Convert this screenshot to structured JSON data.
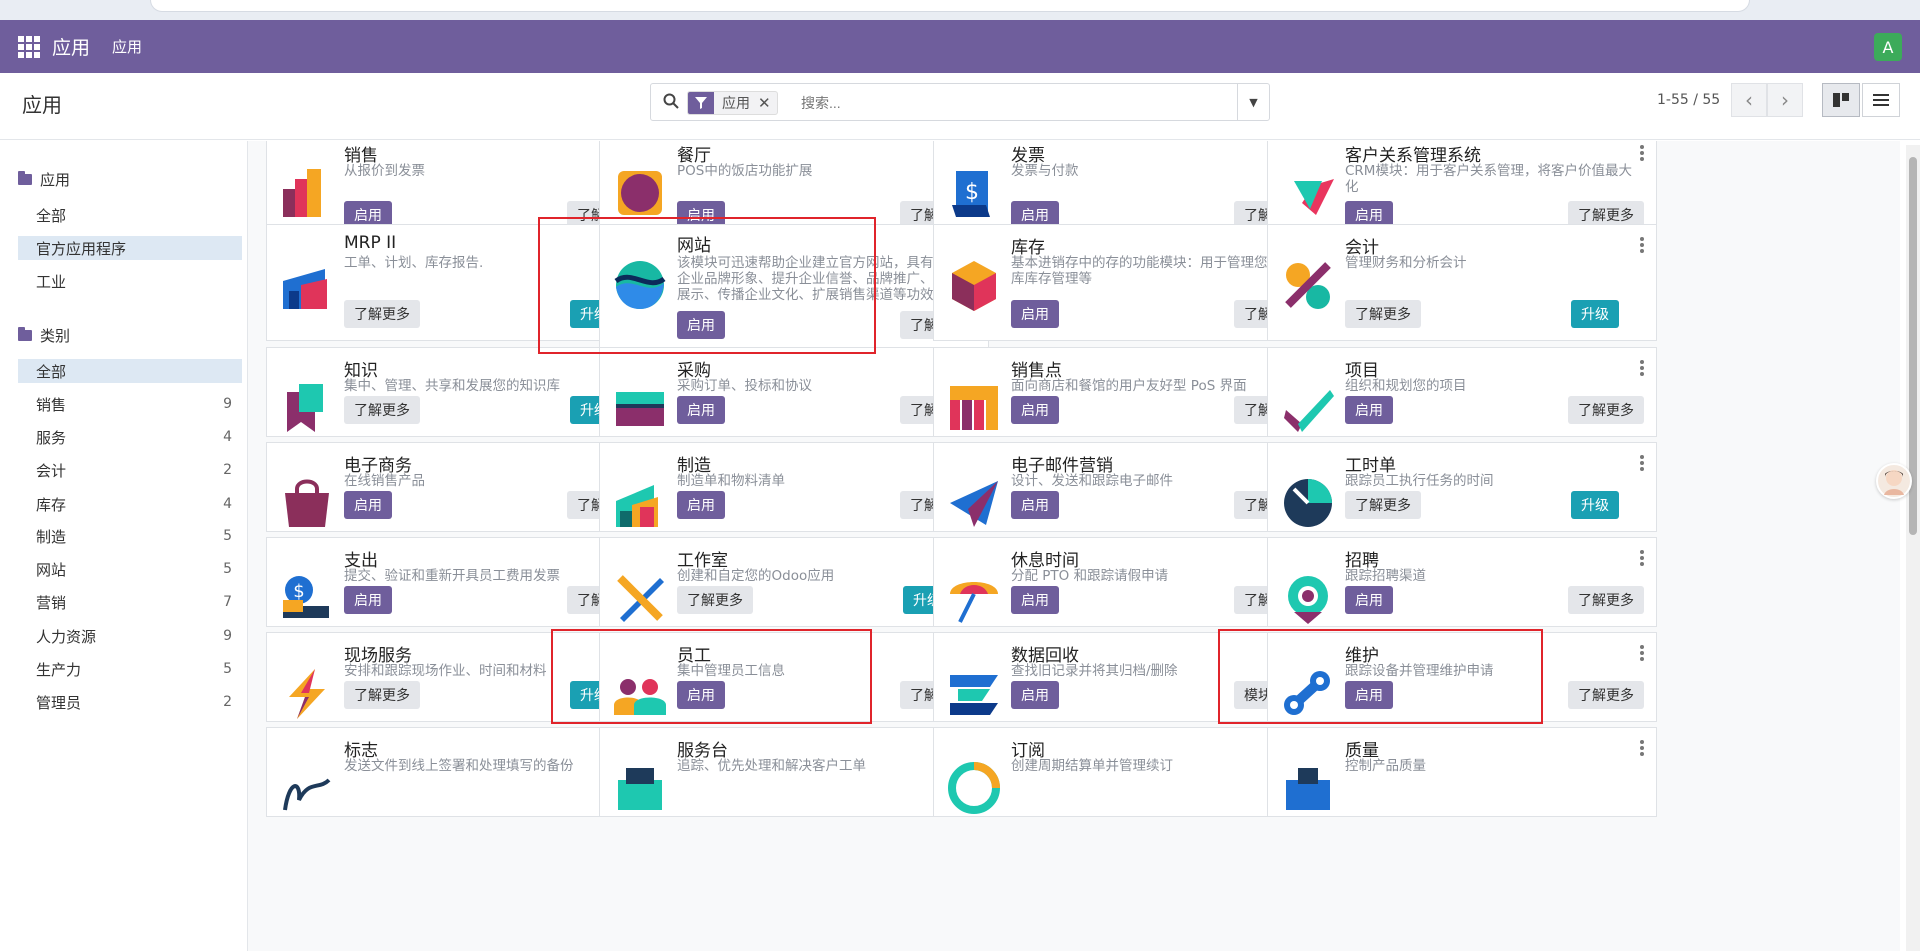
{
  "topnav": {
    "brand": "应用",
    "menu": "应用",
    "user_initial": "A"
  },
  "control": {
    "title": "应用",
    "facet_label": "应用",
    "search_placeholder": "搜索...",
    "pager": "1-55 / 55"
  },
  "sidebar": {
    "sections": [
      {
        "title": "应用",
        "items": [
          {
            "label": "全部",
            "count": ""
          },
          {
            "label": "官方应用程序",
            "count": "",
            "selected": true
          },
          {
            "label": "工业",
            "count": ""
          }
        ]
      },
      {
        "title": "类别",
        "items": [
          {
            "label": "全部",
            "count": "",
            "selected": true
          },
          {
            "label": "销售",
            "count": "9"
          },
          {
            "label": "服务",
            "count": "4"
          },
          {
            "label": "会计",
            "count": "2"
          },
          {
            "label": "库存",
            "count": "4"
          },
          {
            "label": "制造",
            "count": "5"
          },
          {
            "label": "网站",
            "count": "5"
          },
          {
            "label": "营销",
            "count": "7"
          },
          {
            "label": "人力资源",
            "count": "9"
          },
          {
            "label": "生产力",
            "count": "5"
          },
          {
            "label": "管理员",
            "count": "2"
          }
        ]
      }
    ]
  },
  "apps": [
    {
      "name": "销售",
      "desc": "从报价到发票",
      "left": "启用",
      "right": "了解更多",
      "icon": "sales-icon"
    },
    {
      "name": "餐厅",
      "desc": "POS中的饭店功能扩展",
      "left": "启用",
      "right": "了解更多",
      "icon": "restaurant-icon"
    },
    {
      "name": "发票",
      "desc": "发票与付款",
      "left": "启用",
      "right": "了解更多",
      "icon": "invoice-icon"
    },
    {
      "name": "客户关系管理系统",
      "desc": "CRM模块：用于客户关系管理，将客户价值最大化",
      "left": "启用",
      "right": "了解更多",
      "icon": "crm-icon"
    },
    {
      "name": "MRP II",
      "desc": "工单、计划、库存报告.",
      "left": "了解更多",
      "right": "升级",
      "icon": "mrp-icon"
    },
    {
      "name": "网站",
      "desc": "该模块可迅速帮助企业建立官方网站，具有树立企业品牌形象、提升企业信誉、品牌推广、产品展示、传播企业文化、扩展销售渠道等功效",
      "left": "启用",
      "right": "了解更多",
      "icon": "website-icon"
    },
    {
      "name": "库存",
      "desc": "基本进销存中的存的功能模块：用于管理您的仓库库存管理等",
      "left": "启用",
      "right": "了解更多",
      "icon": "inventory-icon"
    },
    {
      "name": "会计",
      "desc": "管理财务和分析会计",
      "left": "了解更多",
      "right": "升级",
      "icon": "accounting-icon"
    },
    {
      "name": "知识",
      "desc": "集中、管理、共享和发展您的知识库",
      "left": "了解更多",
      "right": "升级",
      "icon": "knowledge-icon"
    },
    {
      "name": "采购",
      "desc": "采购订单、投标和协议",
      "left": "启用",
      "right": "了解更多",
      "icon": "purchase-icon"
    },
    {
      "name": "销售点",
      "desc": "面向商店和餐馆的用户友好型 PoS 界面",
      "left": "启用",
      "right": "了解更多",
      "icon": "pos-icon"
    },
    {
      "name": "项目",
      "desc": "组织和规划您的项目",
      "left": "启用",
      "right": "了解更多",
      "icon": "project-icon"
    },
    {
      "name": "电子商务",
      "desc": "在线销售产品",
      "left": "启用",
      "right": "了解更多",
      "icon": "ecommerce-icon"
    },
    {
      "name": "制造",
      "desc": "制造单和物料清单",
      "left": "启用",
      "right": "了解更多",
      "icon": "manufacturing-icon"
    },
    {
      "name": "电子邮件营销",
      "desc": "设计、发送和跟踪电子邮件",
      "left": "启用",
      "right": "了解更多",
      "icon": "email-marketing-icon"
    },
    {
      "name": "工时单",
      "desc": "跟踪员工执行任务的时间",
      "left": "了解更多",
      "right": "升级",
      "icon": "timesheet-icon"
    },
    {
      "name": "支出",
      "desc": "提交、验证和重新开具员工费用发票",
      "left": "启用",
      "right": "了解更多",
      "icon": "expenses-icon"
    },
    {
      "name": "工作室",
      "desc": "创建和自定您的Odoo应用",
      "left": "了解更多",
      "right": "升级",
      "icon": "studio-icon"
    },
    {
      "name": "休息时间",
      "desc": "分配 PTO 和跟踪请假申请",
      "left": "启用",
      "right": "了解更多",
      "icon": "timeoff-icon"
    },
    {
      "name": "招聘",
      "desc": "跟踪招聘渠道",
      "left": "启用",
      "right": "了解更多",
      "icon": "recruitment-icon"
    },
    {
      "name": "现场服务",
      "desc": "安排和跟踪现场作业、时间和材料",
      "left": "了解更多",
      "right": "升级",
      "icon": "field-service-icon"
    },
    {
      "name": "员工",
      "desc": "集中管理员工信息",
      "left": "启用",
      "right": "了解更多",
      "icon": "employees-icon"
    },
    {
      "name": "数据回收",
      "desc": "查找旧记录并将其归档/删除",
      "left": "启用",
      "right": "模块信息",
      "icon": "data-recycle-icon"
    },
    {
      "name": "维护",
      "desc": "跟踪设备并管理维护申请",
      "left": "启用",
      "right": "了解更多",
      "icon": "maintenance-icon"
    },
    {
      "name": "标志",
      "desc": "发送文件到线上签署和处理填写的备份",
      "left": "",
      "right": "",
      "icon": "sign-icon"
    },
    {
      "name": "服务台",
      "desc": "追踪、优先处理和解决客户工单",
      "left": "",
      "right": "",
      "icon": "helpdesk-icon"
    },
    {
      "name": "订阅",
      "desc": "创建周期结算单并管理续订",
      "left": "",
      "right": "",
      "icon": "subscription-icon"
    },
    {
      "name": "质量",
      "desc": "控制产品质量",
      "left": "",
      "right": "",
      "icon": "quality-icon"
    }
  ]
}
